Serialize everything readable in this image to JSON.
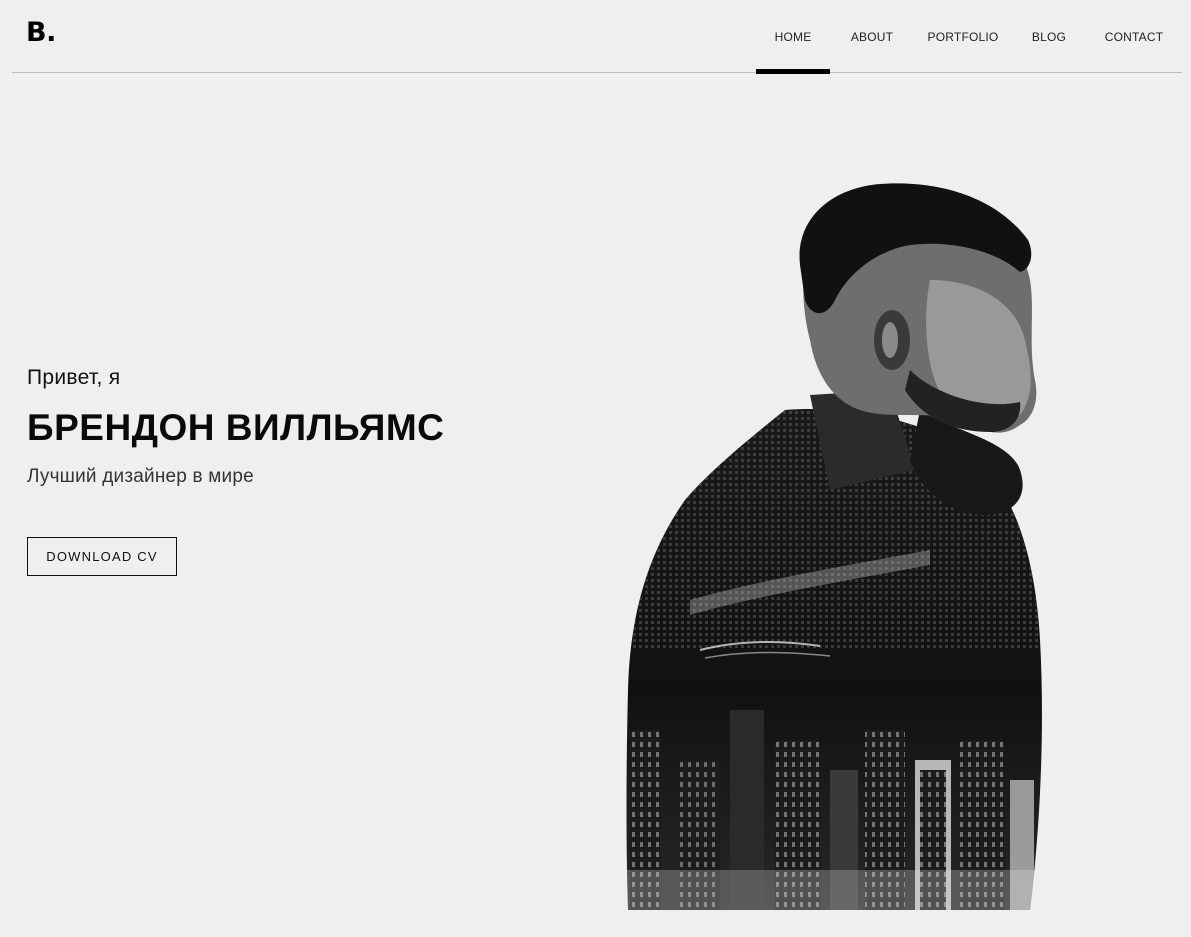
{
  "logo": "B.",
  "nav": {
    "items": [
      {
        "label": "HOME",
        "active": true
      },
      {
        "label": "ABOUT",
        "active": false
      },
      {
        "label": "PORTFOLIO",
        "active": false
      },
      {
        "label": "BLOG",
        "active": false
      },
      {
        "label": "CONTACT",
        "active": false
      }
    ]
  },
  "hero": {
    "greeting": "Привет, я",
    "name": "БРЕНДОН ВИЛЛЬЯМС",
    "tagline": "Лучший дизайнер в мире",
    "button_label": "DOWNLOAD CV"
  },
  "portrait": {
    "image": "double-exposure-man-city-silhouette"
  },
  "colors": {
    "background": "#efefef",
    "text": "#111111",
    "accent": "#000000",
    "divider": "#bdbdbd"
  }
}
